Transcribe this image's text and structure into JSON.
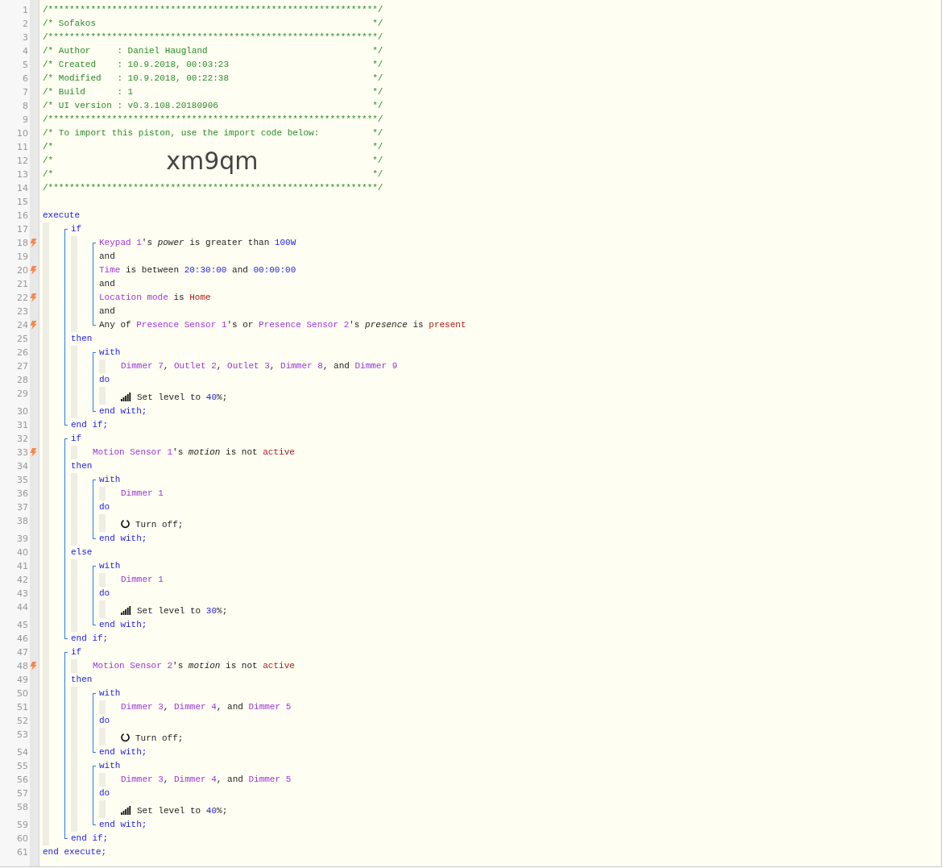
{
  "editor": {
    "lines": [
      {
        "kind": "comment",
        "number": "1",
        "trigger": false,
        "text": "/**************************************************************/"
      },
      {
        "kind": "comment",
        "number": "2",
        "trigger": false,
        "text": "/* Sofakos",
        "end": "*/"
      },
      {
        "kind": "comment",
        "number": "3",
        "trigger": false,
        "text": "/**************************************************************/"
      },
      {
        "kind": "comment",
        "number": "4",
        "trigger": false,
        "text": "/* Author     : Daniel Haugland",
        "end": "*/"
      },
      {
        "kind": "comment",
        "number": "5",
        "trigger": false,
        "text": "/* Created    : 10.9.2018, 00:03:23",
        "end": "*/"
      },
      {
        "kind": "comment",
        "number": "6",
        "trigger": false,
        "text": "/* Modified   : 10.9.2018, 00:22:38",
        "end": "*/"
      },
      {
        "kind": "comment",
        "number": "7",
        "trigger": false,
        "text": "/* Build      : 1",
        "end": "*/"
      },
      {
        "kind": "comment",
        "number": "8",
        "trigger": false,
        "text": "/* UI version : v0.3.108.20180906",
        "end": "*/"
      },
      {
        "kind": "comment",
        "number": "9",
        "trigger": false,
        "text": "/**************************************************************/"
      },
      {
        "kind": "comment",
        "number": "10",
        "trigger": false,
        "text": "/* To import this piston, use the import code below:",
        "end": "*/"
      },
      {
        "kind": "comment",
        "number": "11",
        "trigger": false,
        "text": "/*",
        "end": "*/"
      },
      {
        "kind": "code",
        "number": "12",
        "trigger": false,
        "text": "/*",
        "code": "xm9qm",
        "end": "*/"
      },
      {
        "kind": "comment",
        "number": "13",
        "trigger": false,
        "text": "/*",
        "end": "*/"
      },
      {
        "kind": "comment",
        "number": "14",
        "trigger": false,
        "text": "/**************************************************************/"
      },
      {
        "kind": "line",
        "number": "15",
        "trigger": false
      },
      {
        "kind": "line",
        "number": "16",
        "trigger": false,
        "tokens": [
          {
            "kind": "keyword",
            "text": "execute"
          }
        ]
      },
      {
        "kind": "indent",
        "children": [
          {
            "kind": "bracket",
            "children": [
              {
                "kind": "line",
                "number": "17",
                "trigger": false,
                "tokens": [
                  {
                    "kind": "keyword",
                    "text": "if"
                  }
                ]
              },
              {
                "kind": "indent",
                "children": [
                  {
                    "kind": "bracket",
                    "children": [
                      {
                        "kind": "line",
                        "number": "18",
                        "trigger": true,
                        "tokens": [
                          {
                            "kind": "device",
                            "text": "Keypad 1"
                          },
                          {
                            "kind": "plain",
                            "text": "'s "
                          },
                          {
                            "kind": "attribute",
                            "text": "power"
                          },
                          {
                            "kind": "plain",
                            "text": " is greater than "
                          },
                          {
                            "kind": "number",
                            "text": "100W"
                          }
                        ]
                      },
                      {
                        "kind": "line",
                        "number": "19",
                        "trigger": false,
                        "tokens": [
                          {
                            "kind": "plain",
                            "text": "and"
                          }
                        ]
                      },
                      {
                        "kind": "line",
                        "number": "20",
                        "trigger": true,
                        "tokens": [
                          {
                            "kind": "device",
                            "text": "Time"
                          },
                          {
                            "kind": "plain",
                            "text": " is between "
                          },
                          {
                            "kind": "number",
                            "text": "20:30:00"
                          },
                          {
                            "kind": "plain",
                            "text": " and "
                          },
                          {
                            "kind": "number",
                            "text": "00:00:00"
                          }
                        ]
                      },
                      {
                        "kind": "line",
                        "number": "21",
                        "trigger": false,
                        "tokens": [
                          {
                            "kind": "plain",
                            "text": "and"
                          }
                        ]
                      },
                      {
                        "kind": "line",
                        "number": "22",
                        "trigger": true,
                        "tokens": [
                          {
                            "kind": "device",
                            "text": "Location mode"
                          },
                          {
                            "kind": "plain",
                            "text": " is "
                          },
                          {
                            "kind": "value",
                            "text": "Home"
                          }
                        ]
                      },
                      {
                        "kind": "line",
                        "number": "23",
                        "trigger": false,
                        "tokens": [
                          {
                            "kind": "plain",
                            "text": "and"
                          }
                        ]
                      },
                      {
                        "kind": "line",
                        "number": "24",
                        "trigger": true,
                        "tokens": [
                          {
                            "kind": "plain",
                            "text": "Any of "
                          },
                          {
                            "kind": "device",
                            "text": "Presence Sensor 1"
                          },
                          {
                            "kind": "plain",
                            "text": "'s or "
                          },
                          {
                            "kind": "device",
                            "text": "Presence Sensor 2"
                          },
                          {
                            "kind": "plain",
                            "text": "'s "
                          },
                          {
                            "kind": "attribute",
                            "text": "presence"
                          },
                          {
                            "kind": "plain",
                            "text": " is "
                          },
                          {
                            "kind": "value",
                            "text": "present"
                          }
                        ]
                      }
                    ]
                  }
                ]
              },
              {
                "kind": "line",
                "number": "25",
                "trigger": false,
                "tokens": [
                  {
                    "kind": "keyword",
                    "text": "then"
                  }
                ]
              },
              {
                "kind": "indent",
                "children": [
                  {
                    "kind": "bracket",
                    "children": [
                      {
                        "kind": "line",
                        "number": "26",
                        "trigger": false,
                        "tokens": [
                          {
                            "kind": "keyword",
                            "text": "with"
                          }
                        ]
                      },
                      {
                        "kind": "indent",
                        "children": [
                          {
                            "kind": "line",
                            "number": "27",
                            "trigger": false,
                            "tokens": [
                              {
                                "kind": "device",
                                "text": "Dimmer 7"
                              },
                              {
                                "kind": "plain",
                                "text": ", "
                              },
                              {
                                "kind": "device",
                                "text": "Outlet 2"
                              },
                              {
                                "kind": "plain",
                                "text": ", "
                              },
                              {
                                "kind": "device",
                                "text": "Outlet 3"
                              },
                              {
                                "kind": "plain",
                                "text": ", "
                              },
                              {
                                "kind": "device",
                                "text": "Dimmer 8"
                              },
                              {
                                "kind": "plain",
                                "text": ", and "
                              },
                              {
                                "kind": "device",
                                "text": "Dimmer 9"
                              }
                            ]
                          }
                        ]
                      },
                      {
                        "kind": "line",
                        "number": "28",
                        "trigger": false,
                        "tokens": [
                          {
                            "kind": "keyword",
                            "text": "do"
                          }
                        ]
                      },
                      {
                        "kind": "indent",
                        "children": [
                          {
                            "kind": "level_action",
                            "number": "29",
                            "trigger": false,
                            "tokens": [
                              {
                                "kind": "plain",
                                "text": "Set level to "
                              },
                              {
                                "kind": "number",
                                "text": "40"
                              },
                              {
                                "kind": "plain",
                                "text": "%;"
                              }
                            ]
                          }
                        ]
                      },
                      {
                        "kind": "line",
                        "number": "30",
                        "trigger": false,
                        "tokens": [
                          {
                            "kind": "keyword",
                            "text": "end with;"
                          }
                        ]
                      }
                    ]
                  }
                ]
              },
              {
                "kind": "line",
                "number": "31",
                "trigger": false,
                "tokens": [
                  {
                    "kind": "keyword",
                    "text": "end if;"
                  }
                ]
              }
            ]
          },
          {
            "kind": "bracket",
            "children": [
              {
                "kind": "line",
                "number": "32",
                "trigger": false,
                "tokens": [
                  {
                    "kind": "keyword",
                    "text": "if"
                  }
                ]
              },
              {
                "kind": "indent",
                "children": [
                  {
                    "kind": "line",
                    "number": "33",
                    "trigger": true,
                    "tokens": [
                      {
                        "kind": "device",
                        "text": "Motion Sensor 1"
                      },
                      {
                        "kind": "plain",
                        "text": "'s "
                      },
                      {
                        "kind": "attribute",
                        "text": "motion"
                      },
                      {
                        "kind": "plain",
                        "text": " is not "
                      },
                      {
                        "kind": "value",
                        "text": "active"
                      }
                    ]
                  }
                ]
              },
              {
                "kind": "line",
                "number": "34",
                "trigger": false,
                "tokens": [
                  {
                    "kind": "keyword",
                    "text": "then"
                  }
                ]
              },
              {
                "kind": "indent",
                "children": [
                  {
                    "kind": "bracket",
                    "children": [
                      {
                        "kind": "line",
                        "number": "35",
                        "trigger": false,
                        "tokens": [
                          {
                            "kind": "keyword",
                            "text": "with"
                          }
                        ]
                      },
                      {
                        "kind": "indent",
                        "children": [
                          {
                            "kind": "line",
                            "number": "36",
                            "trigger": false,
                            "tokens": [
                              {
                                "kind": "device",
                                "text": "Dimmer 1"
                              }
                            ]
                          }
                        ]
                      },
                      {
                        "kind": "line",
                        "number": "37",
                        "trigger": false,
                        "tokens": [
                          {
                            "kind": "keyword",
                            "text": "do"
                          }
                        ]
                      },
                      {
                        "kind": "indent",
                        "children": [
                          {
                            "kind": "power_action",
                            "number": "38",
                            "trigger": false,
                            "tokens": [
                              {
                                "kind": "plain",
                                "text": "Turn off;"
                              }
                            ]
                          }
                        ]
                      },
                      {
                        "kind": "line",
                        "number": "39",
                        "trigger": false,
                        "tokens": [
                          {
                            "kind": "keyword",
                            "text": "end with;"
                          }
                        ]
                      }
                    ]
                  }
                ]
              },
              {
                "kind": "line",
                "number": "40",
                "trigger": false,
                "tokens": [
                  {
                    "kind": "keyword",
                    "text": "else"
                  }
                ]
              },
              {
                "kind": "indent",
                "children": [
                  {
                    "kind": "bracket",
                    "children": [
                      {
                        "kind": "line",
                        "number": "41",
                        "trigger": false,
                        "tokens": [
                          {
                            "kind": "keyword",
                            "text": "with"
                          }
                        ]
                      },
                      {
                        "kind": "indent",
                        "children": [
                          {
                            "kind": "line",
                            "number": "42",
                            "trigger": false,
                            "tokens": [
                              {
                                "kind": "device",
                                "text": "Dimmer 1"
                              }
                            ]
                          }
                        ]
                      },
                      {
                        "kind": "line",
                        "number": "43",
                        "trigger": false,
                        "tokens": [
                          {
                            "kind": "keyword",
                            "text": "do"
                          }
                        ]
                      },
                      {
                        "kind": "indent",
                        "children": [
                          {
                            "kind": "level_action",
                            "number": "44",
                            "trigger": false,
                            "tokens": [
                              {
                                "kind": "plain",
                                "text": "Set level to "
                              },
                              {
                                "kind": "number",
                                "text": "30"
                              },
                              {
                                "kind": "plain",
                                "text": "%;"
                              }
                            ]
                          }
                        ]
                      },
                      {
                        "kind": "line",
                        "number": "45",
                        "trigger": false,
                        "tokens": [
                          {
                            "kind": "keyword",
                            "text": "end with;"
                          }
                        ]
                      }
                    ]
                  }
                ]
              },
              {
                "kind": "line",
                "number": "46",
                "trigger": false,
                "tokens": [
                  {
                    "kind": "keyword",
                    "text": "end if;"
                  }
                ]
              }
            ]
          },
          {
            "kind": "bracket",
            "children": [
              {
                "kind": "line",
                "number": "47",
                "trigger": false,
                "tokens": [
                  {
                    "kind": "keyword",
                    "text": "if"
                  }
                ]
              },
              {
                "kind": "indent",
                "children": [
                  {
                    "kind": "line",
                    "number": "48",
                    "trigger": true,
                    "tokens": [
                      {
                        "kind": "device",
                        "text": "Motion Sensor 2"
                      },
                      {
                        "kind": "plain",
                        "text": "'s "
                      },
                      {
                        "kind": "attribute",
                        "text": "motion"
                      },
                      {
                        "kind": "plain",
                        "text": " is not "
                      },
                      {
                        "kind": "value",
                        "text": "active"
                      }
                    ]
                  }
                ]
              },
              {
                "kind": "line",
                "number": "49",
                "trigger": false,
                "tokens": [
                  {
                    "kind": "keyword",
                    "text": "then"
                  }
                ]
              },
              {
                "kind": "indent",
                "children": [
                  {
                    "kind": "bracket",
                    "children": [
                      {
                        "kind": "line",
                        "number": "50",
                        "trigger": false,
                        "tokens": [
                          {
                            "kind": "keyword",
                            "text": "with"
                          }
                        ]
                      },
                      {
                        "kind": "indent",
                        "children": [
                          {
                            "kind": "line",
                            "number": "51",
                            "trigger": false,
                            "tokens": [
                              {
                                "kind": "device",
                                "text": "Dimmer 3"
                              },
                              {
                                "kind": "plain",
                                "text": ", "
                              },
                              {
                                "kind": "device",
                                "text": "Dimmer 4"
                              },
                              {
                                "kind": "plain",
                                "text": ", and "
                              },
                              {
                                "kind": "device",
                                "text": "Dimmer 5"
                              }
                            ]
                          }
                        ]
                      },
                      {
                        "kind": "line",
                        "number": "52",
                        "trigger": false,
                        "tokens": [
                          {
                            "kind": "keyword",
                            "text": "do"
                          }
                        ]
                      },
                      {
                        "kind": "indent",
                        "children": [
                          {
                            "kind": "power_action",
                            "number": "53",
                            "trigger": false,
                            "tokens": [
                              {
                                "kind": "plain",
                                "text": "Turn off;"
                              }
                            ]
                          }
                        ]
                      },
                      {
                        "kind": "line",
                        "number": "54",
                        "trigger": false,
                        "tokens": [
                          {
                            "kind": "keyword",
                            "text": "end with;"
                          }
                        ]
                      }
                    ]
                  },
                  {
                    "kind": "bracket",
                    "children": [
                      {
                        "kind": "line",
                        "number": "55",
                        "trigger": false,
                        "tokens": [
                          {
                            "kind": "keyword",
                            "text": "with"
                          }
                        ]
                      },
                      {
                        "kind": "indent",
                        "children": [
                          {
                            "kind": "line",
                            "number": "56",
                            "trigger": false,
                            "tokens": [
                              {
                                "kind": "device",
                                "text": "Dimmer 3"
                              },
                              {
                                "kind": "plain",
                                "text": ", "
                              },
                              {
                                "kind": "device",
                                "text": "Dimmer 4"
                              },
                              {
                                "kind": "plain",
                                "text": ", and "
                              },
                              {
                                "kind": "device",
                                "text": "Dimmer 5"
                              }
                            ]
                          }
                        ]
                      },
                      {
                        "kind": "line",
                        "number": "57",
                        "trigger": false,
                        "tokens": [
                          {
                            "kind": "keyword",
                            "text": "do"
                          }
                        ]
                      },
                      {
                        "kind": "indent",
                        "children": [
                          {
                            "kind": "level_action",
                            "number": "58",
                            "trigger": false,
                            "tokens": [
                              {
                                "kind": "plain",
                                "text": "Set level to "
                              },
                              {
                                "kind": "number",
                                "text": "40"
                              },
                              {
                                "kind": "plain",
                                "text": "%;"
                              }
                            ]
                          }
                        ]
                      },
                      {
                        "kind": "line",
                        "number": "59",
                        "trigger": false,
                        "tokens": [
                          {
                            "kind": "keyword",
                            "text": "end with;"
                          }
                        ]
                      }
                    ]
                  }
                ]
              },
              {
                "kind": "line",
                "number": "60",
                "trigger": false,
                "tokens": [
                  {
                    "kind": "keyword",
                    "text": "end if;"
                  }
                ]
              }
            ]
          }
        ]
      },
      {
        "kind": "line",
        "number": "61",
        "trigger": false,
        "tokens": [
          {
            "kind": "keyword",
            "text": "end execute;"
          }
        ]
      }
    ]
  }
}
